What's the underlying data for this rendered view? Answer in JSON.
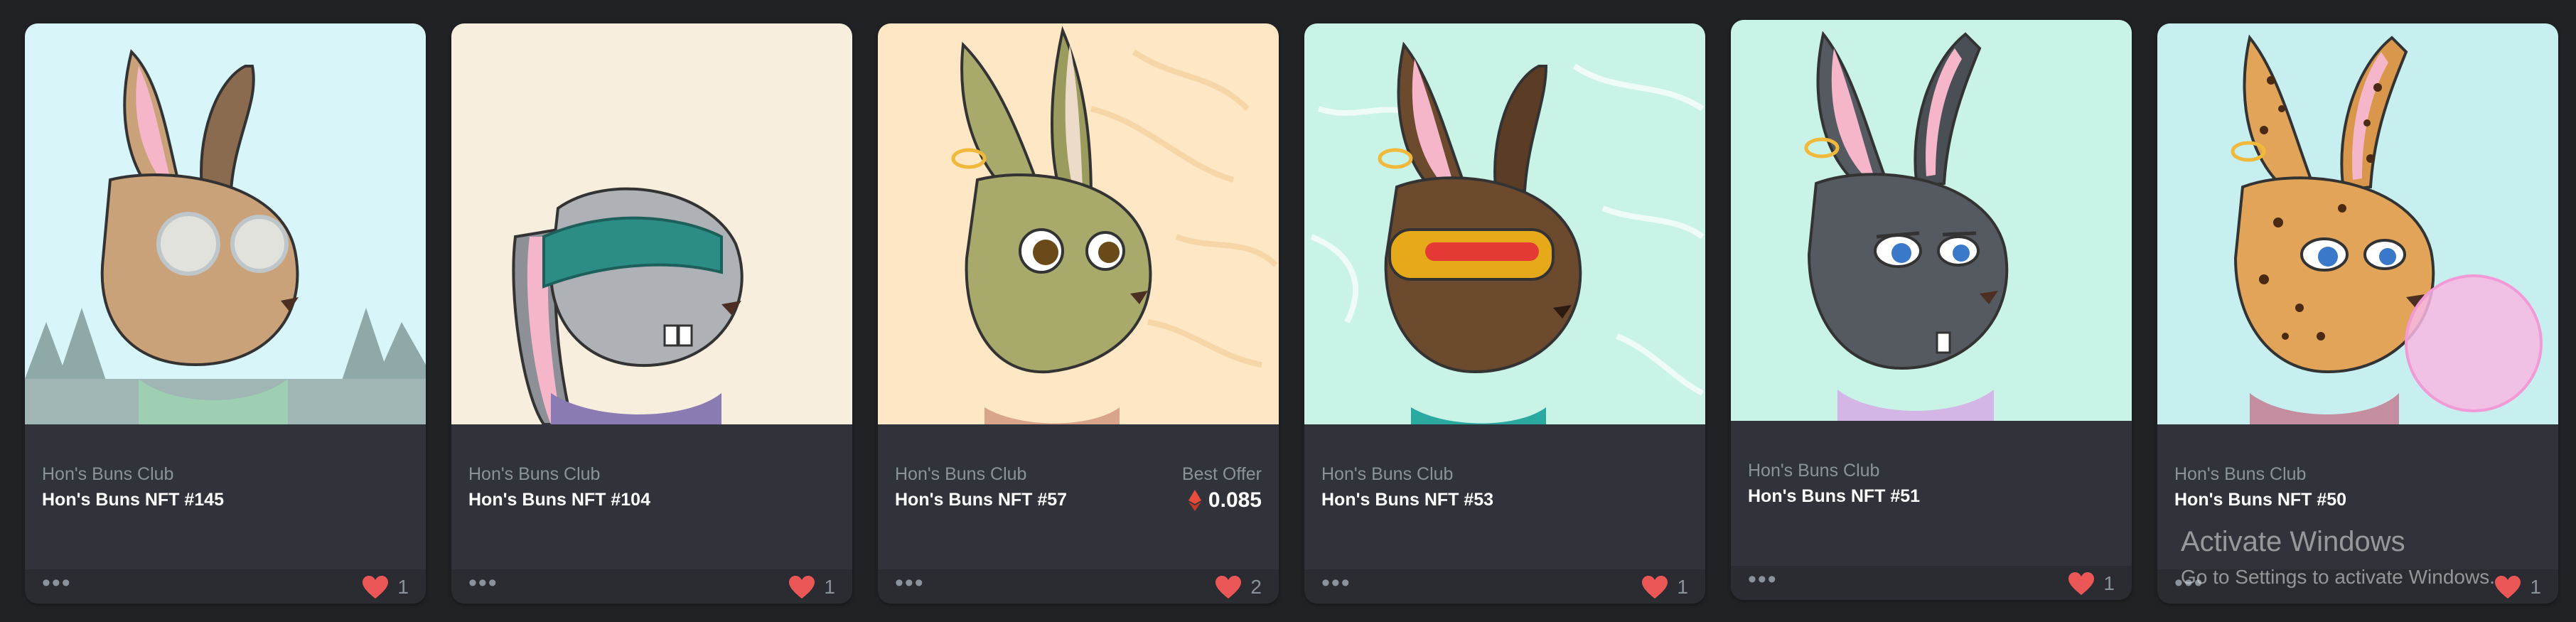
{
  "cards": [
    {
      "collection": "Hon's Buns Club",
      "name": "Hon's Buns NFT #145",
      "likes": "1",
      "menu_icon": "ellipsis-icon",
      "like_icon": "heart-icon",
      "background": "#d8f6fa",
      "fur": "#c9a27a",
      "ear": "#8a6b4f",
      "inner_ear": "#f4b6c8",
      "accessory": "monocle",
      "scene": "pine trees"
    },
    {
      "collection": "Hon's Buns Club",
      "name": "Hon's Buns NFT #104",
      "likes": "1",
      "menu_icon": "ellipsis-icon",
      "like_icon": "heart-icon",
      "background": "#f7eedd",
      "fur": "#aeb1b6",
      "ear": "#8d9096",
      "inner_ear": "#f4b6c8",
      "accessory": "teal blindfold"
    },
    {
      "collection": "Hon's Buns Club",
      "name": "Hon's Buns NFT #57",
      "best_offer_label": "Best Offer",
      "best_offer_price": "0.085",
      "price_icon": "ethereum-icon",
      "likes": "2",
      "menu_icon": "ellipsis-icon",
      "like_icon": "heart-icon",
      "background": "#fde7c4",
      "fur": "#a8aa6b",
      "ear": "#9a9c5e",
      "inner_ear": "#eddbc9",
      "accessory": "earrings"
    },
    {
      "collection": "Hon's Buns Club",
      "name": "Hon's Buns NFT #53",
      "likes": "1",
      "menu_icon": "ellipsis-icon",
      "like_icon": "heart-icon",
      "background": "#c9f3e6",
      "fur": "#6b4a2e",
      "ear": "#5b3d25",
      "inner_ear": "#f4b6c8",
      "accessory": "visor"
    },
    {
      "collection": "Hon's Buns Club",
      "name": "Hon's Buns NFT #51",
      "likes": "1",
      "menu_icon": "ellipsis-icon",
      "like_icon": "heart-icon",
      "background": "#c9f3e6",
      "fur": "#555a60",
      "ear": "#4a4f55",
      "inner_ear": "#f4b6c8",
      "accessory": "earrings"
    },
    {
      "collection": "Hon's Buns Club",
      "name": "Hon's Buns NFT #50",
      "likes": "1",
      "menu_icon": "ellipsis-icon",
      "like_icon": "heart-icon",
      "background": "#c7eff0",
      "fur": "#e2a458",
      "ear": "#d8974a",
      "inner_ear": "#f4b6c8",
      "accessory": "bubblegum"
    }
  ],
  "watermark": {
    "line1": "Activate Windows",
    "line2": "Go to Settings to activate Windows."
  },
  "colors": {
    "page_bg": "#202225",
    "card_bg": "#303339",
    "footer_bg": "#2a2c31",
    "heart": "#eb5757",
    "eth": "#e74c3c",
    "muted_text": "#8a939b"
  }
}
